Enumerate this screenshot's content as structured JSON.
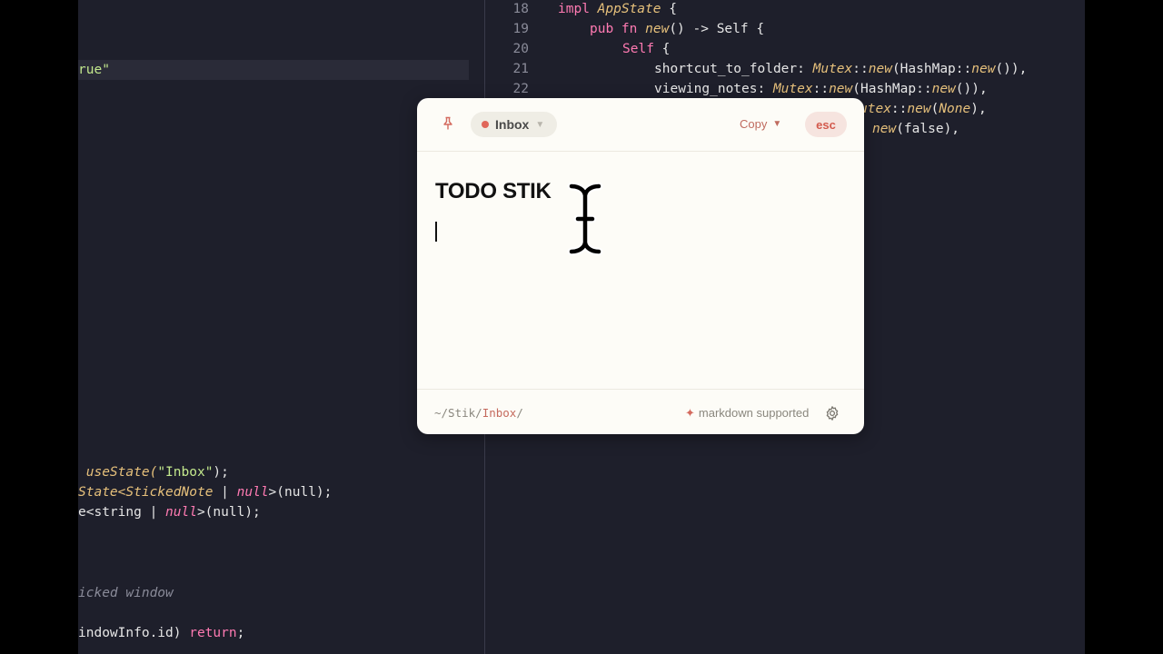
{
  "editor_left": {
    "line_a": "rue\"",
    "line_b": [
      " useState(",
      "\"Inbox\"",
      ");"
    ],
    "line_c": [
      "State<",
      "StickedNote",
      " | ",
      "null",
      ">(null);"
    ],
    "line_d": [
      "e<string | ",
      "null",
      ">(null);"
    ],
    "comment": "icked window",
    "line_e": [
      "indowInfo.id) ",
      "return",
      ";"
    ]
  },
  "editor_right": {
    "line_numbers": [
      "18",
      "19",
      "20",
      "21",
      "22"
    ],
    "l18": [
      "impl ",
      "AppState",
      " {"
    ],
    "l19": [
      "pub fn ",
      "new",
      "() -> Self {"
    ],
    "l20": [
      "Self",
      " {"
    ],
    "l21": [
      "shortcut_to_folder: ",
      "Mutex",
      "::",
      "new",
      "(HashMap::",
      "new",
      "()),"
    ],
    "l22": [
      "viewing_notes: ",
      "Mutex",
      "::",
      "new",
      "(HashMap::",
      "new",
      "()),"
    ],
    "l23": [
      "utex",
      "::",
      "new",
      "(",
      "None",
      "),"
    ],
    "l24": [
      "new",
      "(false),"
    ]
  },
  "popup": {
    "folder": "Inbox",
    "copy_label": "Copy",
    "esc_label": "esc",
    "note_title": "TODO STIK",
    "path_prefix": "~/Stik/",
    "path_folder": "Inbox",
    "path_suffix": "/",
    "markdown_label": "markdown supported",
    "colors": {
      "accent": "#d46a5e",
      "background": "#fdfcf7"
    },
    "icons": [
      "pin-icon",
      "caret-down-icon",
      "gear-icon",
      "text-cursor-icon"
    ]
  }
}
